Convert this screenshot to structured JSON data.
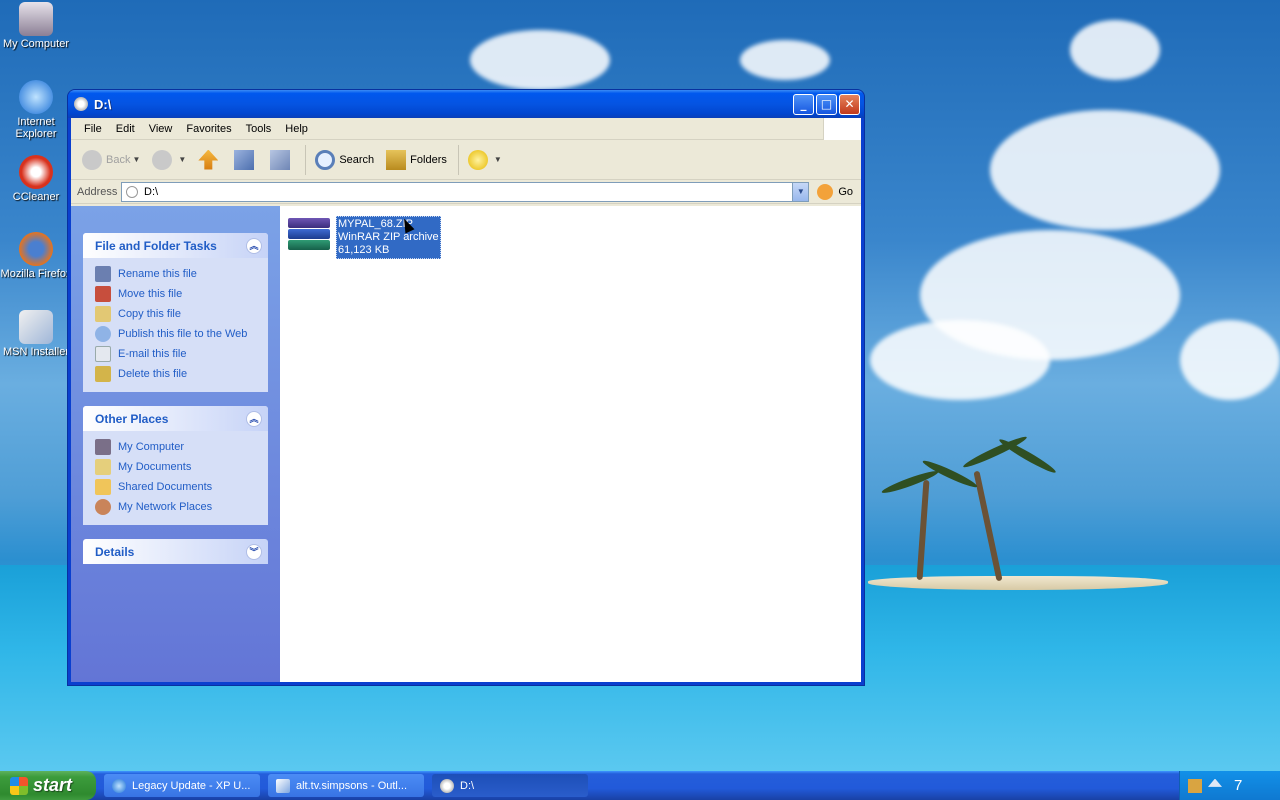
{
  "desktop": {
    "icons": [
      {
        "label": "My Computer"
      },
      {
        "label": "Internet Explorer"
      },
      {
        "label": "CCleaner"
      },
      {
        "label": "Mozilla Firefox"
      },
      {
        "label": "MSN Installer"
      }
    ]
  },
  "window": {
    "title": "D:\\",
    "menu": [
      "File",
      "Edit",
      "View",
      "Favorites",
      "Tools",
      "Help"
    ],
    "toolbar": {
      "back": "Back",
      "search": "Search",
      "folders": "Folders"
    },
    "address": {
      "label": "Address",
      "value": "D:\\",
      "go": "Go"
    },
    "sidebar": {
      "file_tasks": {
        "title": "File and Folder Tasks",
        "items": [
          "Rename this file",
          "Move this file",
          "Copy this file",
          "Publish this file to the Web",
          "E-mail this file",
          "Delete this file"
        ]
      },
      "other_places": {
        "title": "Other Places",
        "items": [
          "My Computer",
          "My Documents",
          "Shared Documents",
          "My Network Places"
        ]
      },
      "details": {
        "title": "Details"
      }
    },
    "files": [
      {
        "name": "MYPAL_68.ZIP",
        "type": "WinRAR ZIP archive",
        "size": "61,123 KB"
      }
    ]
  },
  "taskbar": {
    "start": "start",
    "tasks": [
      {
        "label": "Legacy Update - XP U..."
      },
      {
        "label": "alt.tv.simpsons - Outl..."
      },
      {
        "label": "D:\\"
      }
    ],
    "clock": "7"
  },
  "colors": {
    "link_blue": "#215dc6",
    "selection": "#316ac5",
    "title_blue": "#0554e2"
  }
}
